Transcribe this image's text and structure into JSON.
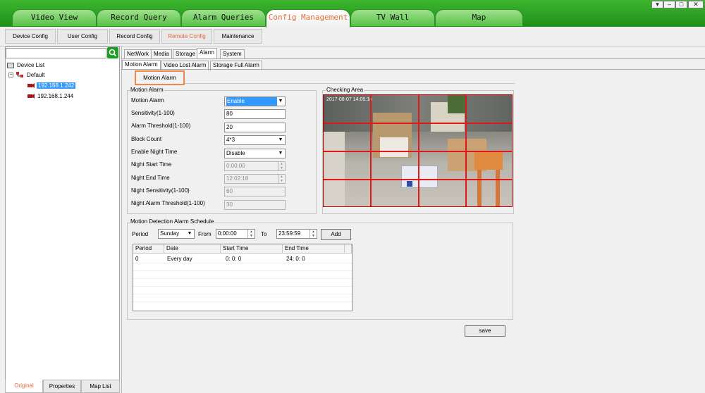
{
  "main_tabs": [
    {
      "label": "Video View"
    },
    {
      "label": "Record Query"
    },
    {
      "label": "Alarm Queries"
    },
    {
      "label": "Config Management"
    },
    {
      "label": "TV Wall"
    },
    {
      "label": "Map"
    }
  ],
  "active_main_tab": "Config Management",
  "window_controls": {
    "menu": "▾",
    "minimize": "–",
    "maximize": "□",
    "close": "✕"
  },
  "sub_toolbar": [
    {
      "label": "Device Config"
    },
    {
      "label": "User Config"
    },
    {
      "label": "Record Config"
    },
    {
      "label": "Remote Config"
    },
    {
      "label": "Maintenance"
    }
  ],
  "tree": {
    "root": "Device List",
    "group": "Default",
    "devices": [
      "192.168.1.242",
      "192.168.1.244"
    ]
  },
  "bottom_tabs": [
    {
      "label": "Original"
    },
    {
      "label": "Properties"
    },
    {
      "label": "Map List"
    }
  ],
  "config_tabs": [
    {
      "label": "NetWork"
    },
    {
      "label": "Media"
    },
    {
      "label": "Storage"
    },
    {
      "label": "Alarm"
    },
    {
      "label": "System"
    }
  ],
  "alarm_tabs": [
    {
      "label": "Motion Alarm"
    },
    {
      "label": "Video Lost Alarm"
    },
    {
      "label": "Storage Full Alarm"
    }
  ],
  "highlighted_button": "Motion Alarm",
  "motion_group": {
    "title": "Motion Alarm",
    "fields": [
      {
        "label": "Motion Alarm",
        "value": "Enable",
        "kind": "select"
      },
      {
        "label": "Sensitivity(1-100)",
        "value": "80",
        "kind": "text"
      },
      {
        "label": "Alarm Threshold(1-100)",
        "value": "20",
        "kind": "text"
      },
      {
        "label": "Block Count",
        "value": "4*3",
        "kind": "select"
      },
      {
        "label": "Enable Night Time",
        "value": "Disable",
        "kind": "select"
      },
      {
        "label": "Night Start Time",
        "value": "0:00:00",
        "kind": "time-disabled"
      },
      {
        "label": "Night End Time",
        "value": "12:02:18",
        "kind": "time-disabled"
      },
      {
        "label": "Night Sensitivity(1-100)",
        "value": "60",
        "kind": "disabled"
      },
      {
        "label": "Night Alarm Threshold(1-100)",
        "value": "30",
        "kind": "disabled"
      }
    ]
  },
  "checking_area": {
    "title": "Checking Area",
    "overlay_text": "2017-08-07 14:05:18",
    "grid_color": "#e01818"
  },
  "schedule": {
    "title": "Motion Detection Alarm Schedule",
    "period_label": "Period",
    "period_value": "Sunday",
    "from_label": "From",
    "from_value": "0:00:00",
    "to_label": "To",
    "to_value": "23:59:59",
    "add_label": "Add",
    "columns": [
      "Period",
      "Date",
      "Start Time",
      "End Time"
    ],
    "rows": [
      [
        "0",
        "Every day",
        "0: 0: 0",
        "24: 0: 0"
      ]
    ]
  },
  "save_label": "save",
  "colors": {
    "accent": "#e06a3c",
    "topbar": "#2ea52a",
    "selection": "#3399ff"
  }
}
